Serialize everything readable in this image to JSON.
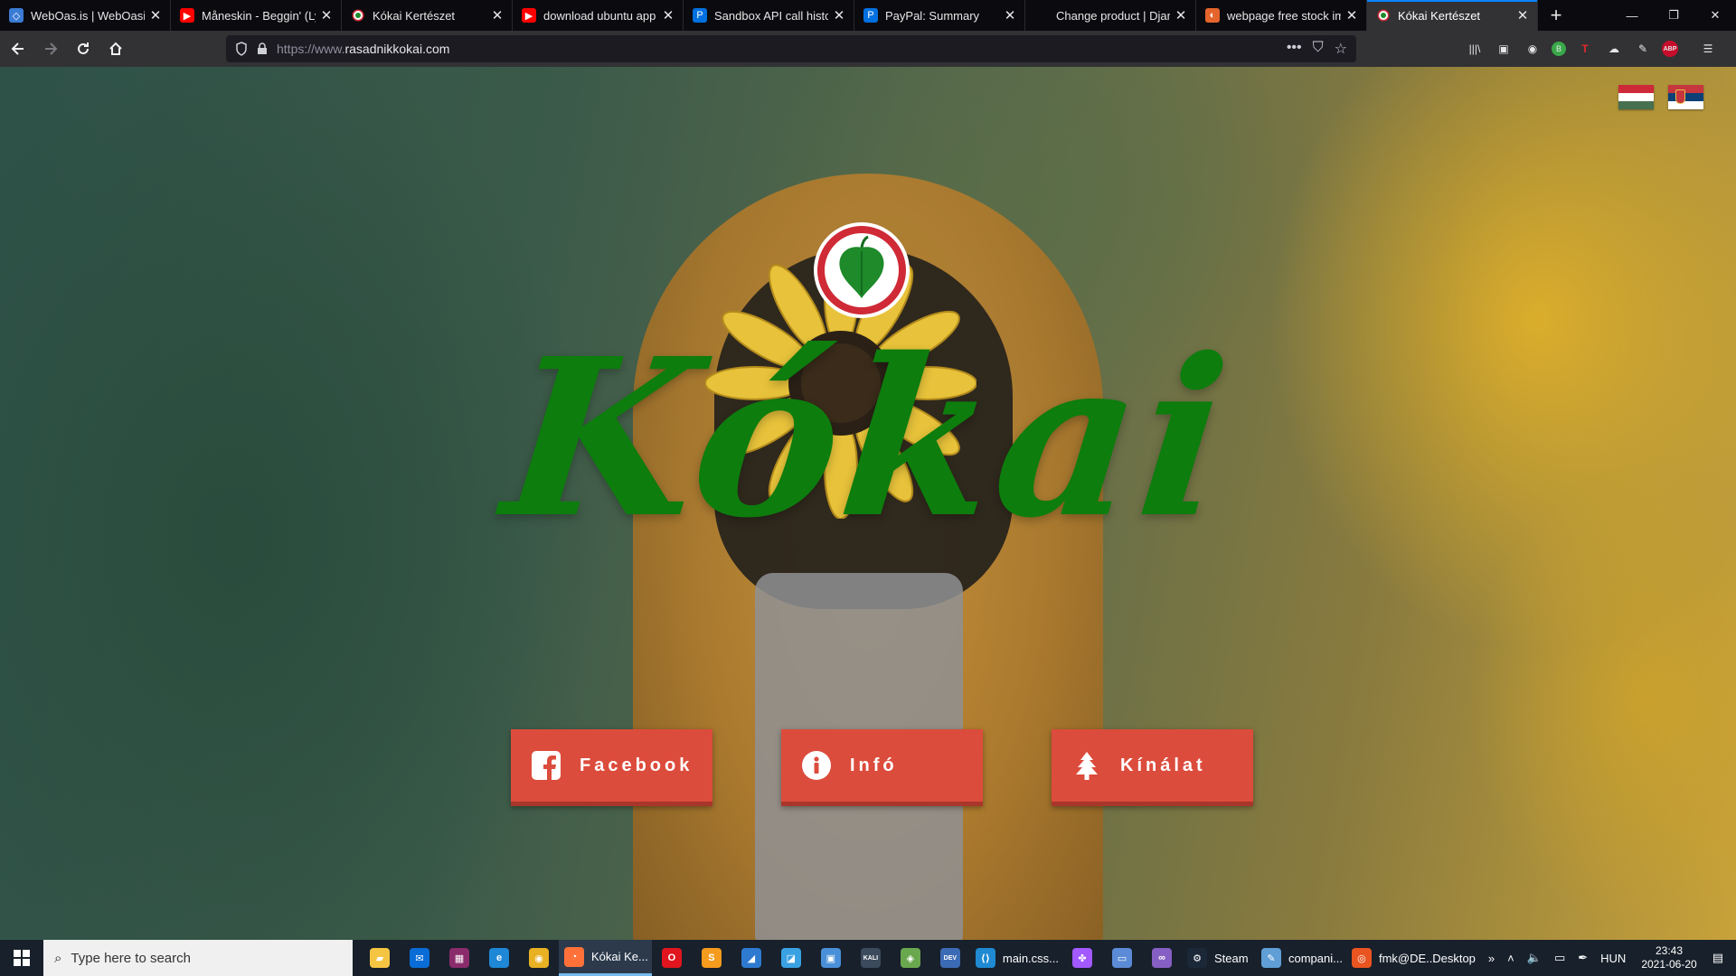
{
  "browser": {
    "tabs": [
      {
        "title": "WebOas.is | WebOasis | ",
        "favicon": "weboasis-icon",
        "active": false
      },
      {
        "title": "Måneskin - Beggin' (Lyr",
        "favicon": "youtube-icon",
        "active": false
      },
      {
        "title": "Kókai Kertészet",
        "favicon": "kokai-icon",
        "active": false
      },
      {
        "title": "download ubuntu app n",
        "favicon": "youtube-icon",
        "active": false
      },
      {
        "title": "Sandbox API call history",
        "favicon": "paypal-icon",
        "active": false
      },
      {
        "title": "PayPal: Summary",
        "favicon": "paypal-icon",
        "active": false
      },
      {
        "title": "Change product | Django site",
        "favicon": "django-icon",
        "active": false
      },
      {
        "title": "webpage free stock ima",
        "favicon": "pexels-icon",
        "active": true
      },
      {
        "title": "Kókai Kertészet",
        "favicon": "kokai-icon",
        "active": true
      }
    ],
    "url": "https://www.rasadnikkokai.com",
    "url_domain": "rasadnikkokai.com",
    "url_prefix": "https://www."
  },
  "page": {
    "brand": "Kókai",
    "brand_color": "#0d7d0d",
    "button_color": "#dc4c3c",
    "languages": [
      {
        "name": "hungarian-flag",
        "colors": [
          "#ce2939",
          "#ffffff",
          "#477050"
        ]
      },
      {
        "name": "serbian-flag",
        "colors": [
          "#c6363c",
          "#0c4076",
          "#ffffff"
        ]
      }
    ],
    "buttons": [
      {
        "label": "Facebook",
        "icon": "facebook-icon"
      },
      {
        "label": "Infó",
        "icon": "info-icon"
      },
      {
        "label": "Kínálat",
        "icon": "tree-icon"
      }
    ]
  },
  "taskbar": {
    "search_placeholder": "Type here to search",
    "apps": [
      {
        "label": "",
        "icon": "file-explorer-icon",
        "color": "#f4c542"
      },
      {
        "label": "",
        "icon": "mail-icon",
        "color": "#0a6cd6"
      },
      {
        "label": "",
        "icon": "winrar-icon",
        "color": "#8a2b6b"
      },
      {
        "label": "",
        "icon": "edge-icon",
        "color": "#1e88d6"
      },
      {
        "label": "",
        "icon": "chrome-icon",
        "color": "#e8b023"
      },
      {
        "label": "Kókai Ke...",
        "icon": "firefox-icon",
        "color": "#ff7139",
        "active": true
      },
      {
        "label": "",
        "icon": "opera-icon",
        "color": "#e0151d"
      },
      {
        "label": "",
        "icon": "sublime-icon",
        "color": "#f59b1d"
      },
      {
        "label": "",
        "icon": "blender-like-icon",
        "color": "#2e7ad1"
      },
      {
        "label": "",
        "icon": "azure-data-studio-icon",
        "color": "#3aa1e3"
      },
      {
        "label": "",
        "icon": "store-icon",
        "color": "#4a90d9"
      },
      {
        "label": "",
        "icon": "kali-icon",
        "color": "#3b4a5c"
      },
      {
        "label": "",
        "icon": "layers-icon",
        "color": "#6aa84f"
      },
      {
        "label": "",
        "icon": "devtools-icon",
        "color": "#3c6bb5"
      },
      {
        "label": "main.css...",
        "icon": "vscode-icon",
        "color": "#1f8ad2"
      },
      {
        "label": "",
        "icon": "figma-icon",
        "color": "#a259ff"
      },
      {
        "label": "",
        "icon": "display-settings-icon",
        "color": "#5b8bd6"
      },
      {
        "label": "",
        "icon": "visual-studio-icon",
        "color": "#865fc5"
      },
      {
        "label": "Steam",
        "icon": "steam-icon",
        "color": "#1b2838"
      },
      {
        "label": "compani...",
        "icon": "notepad-icon",
        "color": "#5f9ed6"
      },
      {
        "label": "fmk@DE...",
        "icon": "ubuntu-icon",
        "color": "#e95420"
      }
    ],
    "desktop_label": "Desktop",
    "language": "HUN",
    "time": "23:43",
    "date": "2021-06-20"
  }
}
